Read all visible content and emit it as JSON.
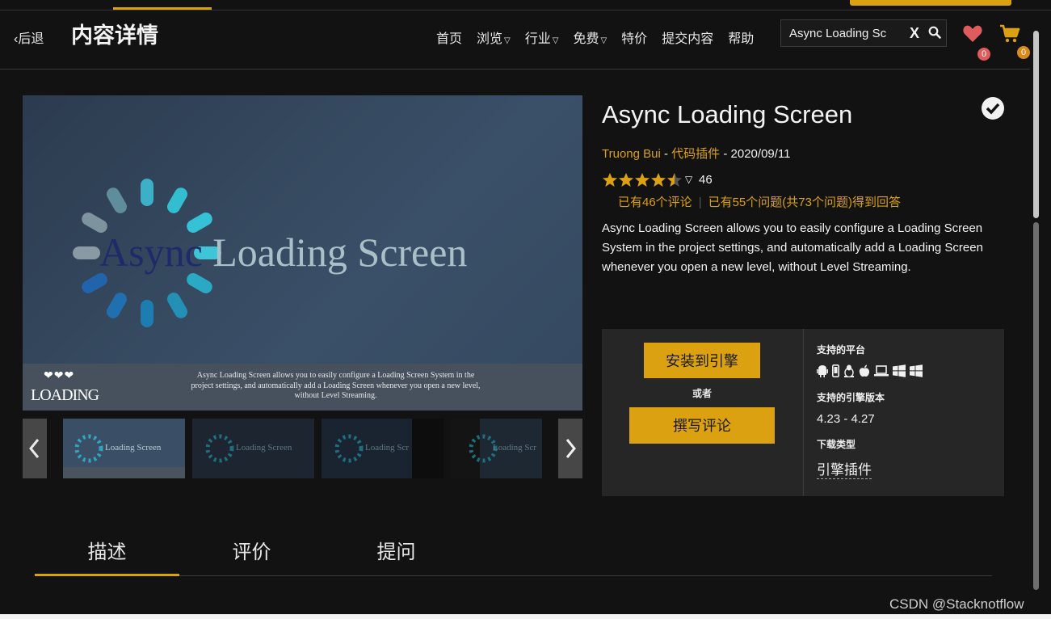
{
  "header": {
    "back_label": "后退",
    "page_title": "内容详情",
    "nav": [
      {
        "label": "首页",
        "has_dropdown": false
      },
      {
        "label": "浏览",
        "has_dropdown": true
      },
      {
        "label": "行业",
        "has_dropdown": true
      },
      {
        "label": "免费",
        "has_dropdown": true
      },
      {
        "label": "特价",
        "has_dropdown": false
      },
      {
        "label": "提交内容",
        "has_dropdown": false
      },
      {
        "label": "帮助",
        "has_dropdown": false
      }
    ],
    "search": {
      "value": "Async Loading Sc",
      "clear_label": "X"
    },
    "wishlist_count": "0",
    "cart_count": "0"
  },
  "hero": {
    "title_dark": "Async",
    "title_light": " Loading Screen",
    "hearts": "❤❤❤",
    "loading_text": "LOADING",
    "caption": "Async Loading Screen allows you to easily configure a Loading Screen System in the project settings, and automatically add a Loading Screen whenever you open a new level, without Level Streaming."
  },
  "thumbnails": [
    {
      "label": "Loading Screen"
    },
    {
      "label": "Loading Screen"
    },
    {
      "label": "Loading Scr"
    },
    {
      "label": "Loading Scr"
    }
  ],
  "product": {
    "title": "Async Loading Screen",
    "author": "Truong Bui",
    "separator1": " - ",
    "category": "代码插件",
    "separator2": " - ",
    "date": "2020/09/11",
    "rating": 4.5,
    "rating_count": "46",
    "reviews_link": "已有46个评论",
    "questions_link": "已有55个问题(共73个问题)得到回答",
    "description": "Async Loading Screen allows you to easily configure a Loading Screen System in the project settings, and automatically add a Loading Screen whenever you open a new level, without Level Streaming."
  },
  "actions": {
    "install_label": "安装到引擎",
    "or_label": "或者",
    "review_label": "撰写评论"
  },
  "specs": {
    "platforms_label": "支持的平台",
    "platform_icons": [
      "android-icon",
      "ios-icon",
      "linux-icon",
      "apple-icon",
      "laptop-icon",
      "windows-icon",
      "windows-store-icon"
    ],
    "versions_label": "支持的引擎版本",
    "versions": "4.23 - 4.27",
    "download_type_label": "下载类型",
    "download_type": "引擎插件"
  },
  "tabs": [
    {
      "label": "描述",
      "active": true
    },
    {
      "label": "评价",
      "active": false
    },
    {
      "label": "提问",
      "active": false
    }
  ],
  "watermark": "CSDN @Stacknotflow",
  "colors": {
    "accent": "#dba111",
    "background": "#121212",
    "panel": "#262626"
  }
}
